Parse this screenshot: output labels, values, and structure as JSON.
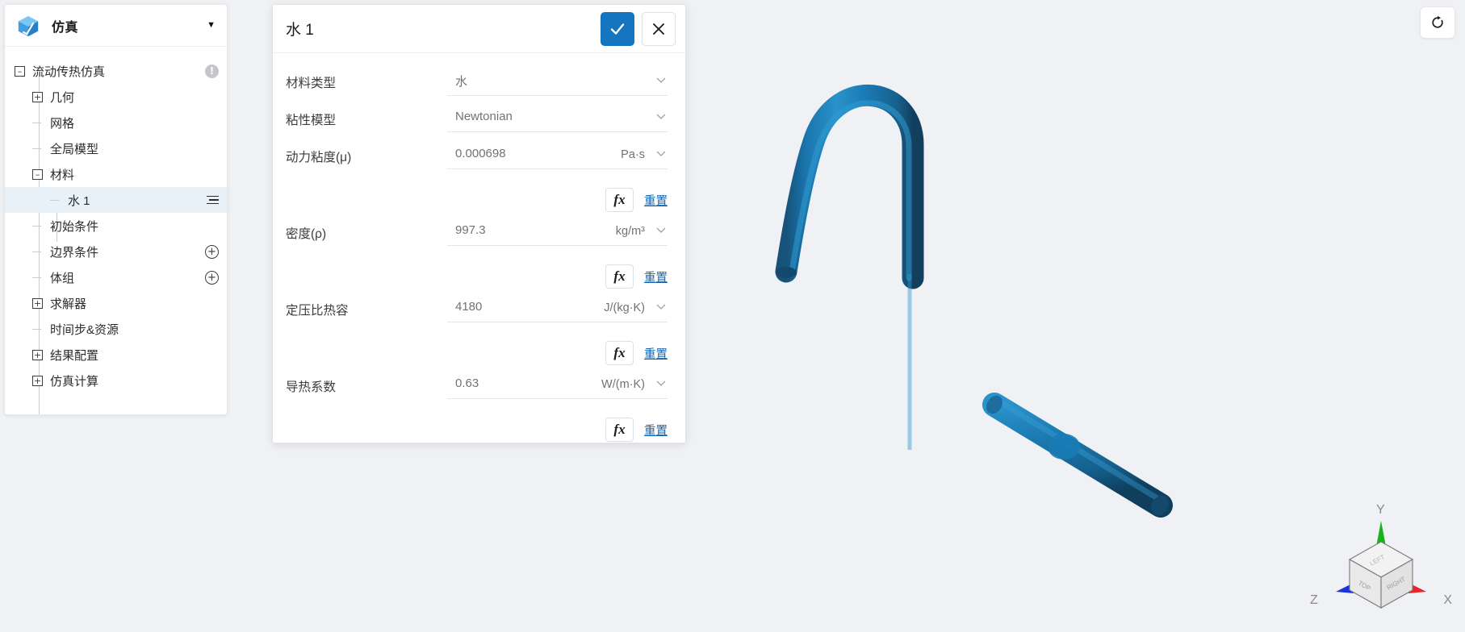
{
  "panel": {
    "title": "仿真",
    "logo_icon": "cube-icon",
    "collapse_icon": "caret-down-icon"
  },
  "tree": {
    "items": [
      {
        "label": "流动传热仿真",
        "toggle": "minus",
        "depth": 0,
        "suffix": "warning",
        "selected": false
      },
      {
        "label": "几何",
        "toggle": "plus",
        "depth": 1,
        "suffix": "none",
        "selected": false
      },
      {
        "label": "网格",
        "toggle": "leaf",
        "depth": 1,
        "suffix": "none",
        "selected": false
      },
      {
        "label": "全局模型",
        "toggle": "leaf",
        "depth": 1,
        "suffix": "none",
        "selected": false
      },
      {
        "label": "材料",
        "toggle": "minus",
        "depth": 1,
        "suffix": "none",
        "selected": false
      },
      {
        "label": "水 1",
        "toggle": "leaf",
        "depth": 2,
        "suffix": "menu",
        "selected": true
      },
      {
        "label": "初始条件",
        "toggle": "leaf",
        "depth": 1,
        "suffix": "none",
        "selected": false
      },
      {
        "label": "边界条件",
        "toggle": "leaf",
        "depth": 1,
        "suffix": "plus",
        "selected": false
      },
      {
        "label": "体组",
        "toggle": "leaf",
        "depth": 1,
        "suffix": "plus",
        "selected": false
      },
      {
        "label": "求解器",
        "toggle": "plus",
        "depth": 1,
        "suffix": "none",
        "selected": false
      },
      {
        "label": "时间步&资源",
        "toggle": "leaf",
        "depth": 1,
        "suffix": "none",
        "selected": false
      },
      {
        "label": "结果配置",
        "toggle": "plus",
        "depth": 1,
        "suffix": "none",
        "selected": false
      },
      {
        "label": "仿真计算",
        "toggle": "plus",
        "depth": 1,
        "suffix": "none",
        "selected": false
      }
    ]
  },
  "dialog": {
    "title": "水 1",
    "confirm_icon": "check-icon",
    "cancel_icon": "close-icon",
    "fields": [
      {
        "label": "材料类型",
        "value": "水",
        "unit": "",
        "kind": "select",
        "has_fx": false,
        "fx_label": "fx",
        "reset_label": "重置"
      },
      {
        "label": "粘性模型",
        "value": "Newtonian",
        "unit": "",
        "kind": "select",
        "has_fx": false,
        "fx_label": "fx",
        "reset_label": "重置"
      },
      {
        "label": "动力粘度(μ)",
        "value": "0.000698",
        "unit": "Pa·s",
        "kind": "number",
        "has_fx": true,
        "fx_label": "fx",
        "reset_label": "重置"
      },
      {
        "label": "密度(ρ)",
        "value": "997.3",
        "unit": "kg/m³",
        "kind": "number",
        "has_fx": true,
        "fx_label": "fx",
        "reset_label": "重置"
      },
      {
        "label": "定压比热容",
        "value": "4180",
        "unit": "J/(kg·K)",
        "kind": "number",
        "has_fx": true,
        "fx_label": "fx",
        "reset_label": "重置"
      },
      {
        "label": "导热系数",
        "value": "0.63",
        "unit": "W/(m·K)",
        "kind": "number",
        "has_fx": true,
        "fx_label": "fx",
        "reset_label": "重置"
      }
    ]
  },
  "viewport": {
    "reset_view_icon": "rotate-reset-icon",
    "model_color": "#1a7bb5",
    "background_color": "#eff1f4",
    "axis_cube": {
      "labels": {
        "x": "X",
        "y": "Y",
        "z": "Z"
      },
      "face_labels": [
        "TOP",
        "LEFT",
        "RIGHT"
      ],
      "axis_colors": {
        "x": "#e8262a",
        "y": "#17b317",
        "z": "#1a32d8"
      }
    }
  }
}
